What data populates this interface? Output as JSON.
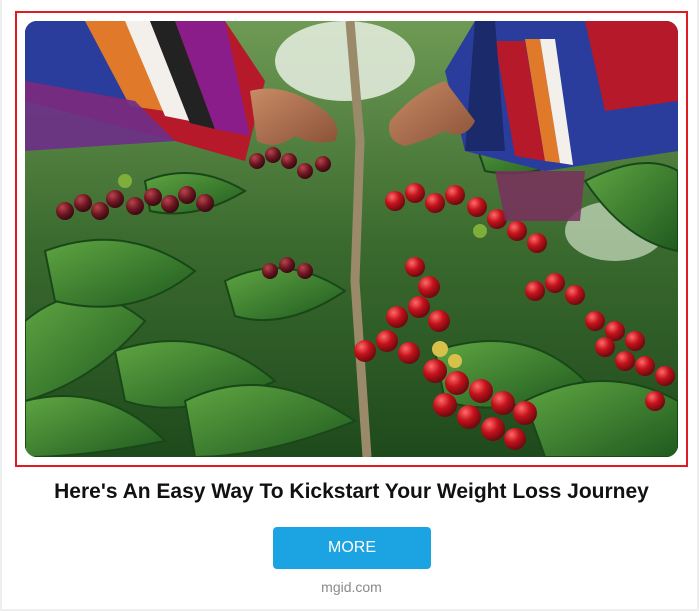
{
  "ad": {
    "headline": "Here's An Easy Way To Kickstart Your Weight Loss Journey",
    "button_label": "MORE",
    "source": "mgid.com",
    "image_subject": "hands picking red coffee cherries"
  },
  "colors": {
    "frame_border": "#e01b22",
    "button_bg": "#1ba3e2",
    "button_text": "#ffffff",
    "headline_text": "#111111",
    "source_text": "#8a8a8a"
  }
}
